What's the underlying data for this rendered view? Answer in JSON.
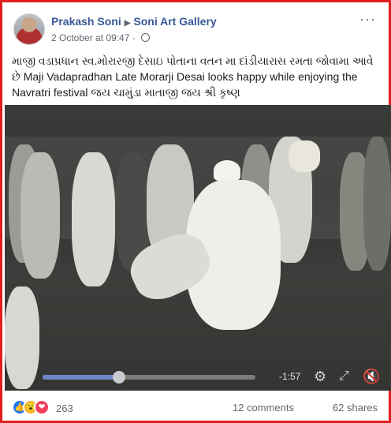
{
  "post": {
    "author": "Prakash Soni",
    "page": "Soni Art Gallery",
    "timestamp": "2 October at 09:47",
    "caption": "માજી વડાપ્રધાન સ્વ.મોરારજી દેસાઇ પોતાના વતન મા દાંડીયારાસ રમતા જોવામા આવે છે Maji Vadapradhan Late Morarji Desai looks happy while enjoying the Navratri festival જય ચામુંડા માતાજી જય શ્રી કૃષ્ણ"
  },
  "video": {
    "time_remaining": "-1:57",
    "progress": 0.36
  },
  "footer": {
    "reaction_count": "263",
    "comments": "12 comments",
    "shares": "62 shares"
  },
  "colors": {
    "border": "#e02020",
    "link": "#385898",
    "progress": "#6e88c7"
  }
}
